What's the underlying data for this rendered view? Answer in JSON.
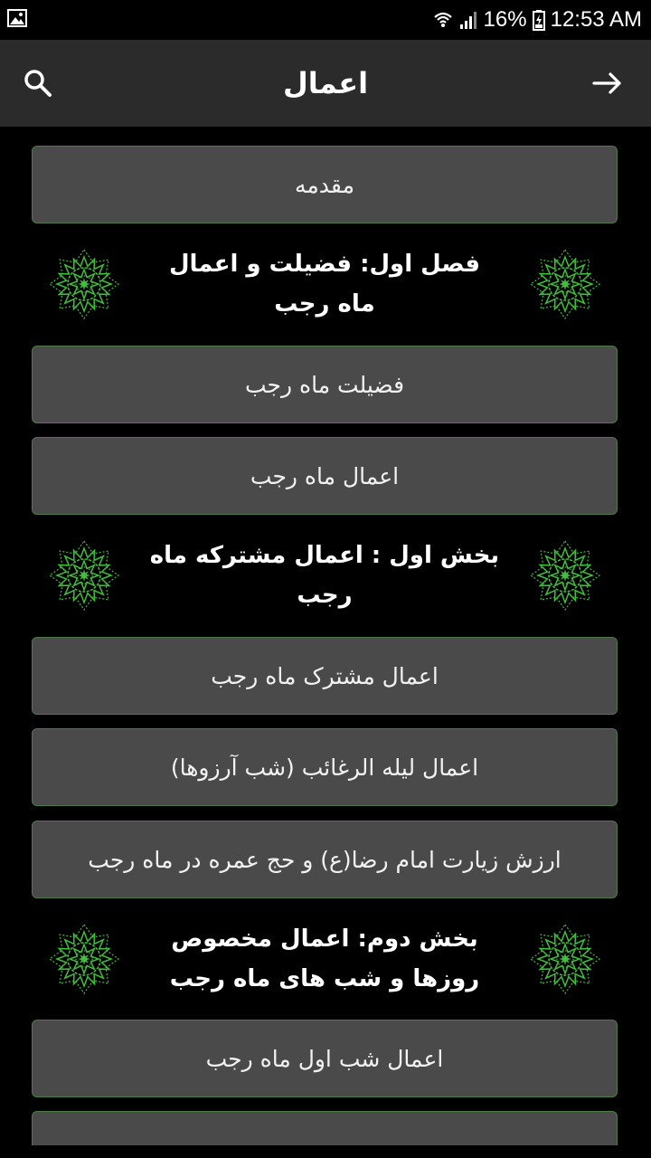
{
  "status_bar": {
    "left_icon": "image-icon",
    "battery_percent": "16%",
    "time": "12:53 AM"
  },
  "app_bar": {
    "title": "اعمال",
    "search_icon": "search-icon",
    "back_icon": "arrow-right-icon"
  },
  "items": {
    "intro": "مقدمه",
    "section1": "فصل اول: فضیلت و اعمال ماه رجب",
    "virtue": "فضیلت ماه رجب",
    "acts": "اعمال ماه رجب",
    "part1": "بخش اول : اعمال مشترکه ماه رجب",
    "common": "اعمال مشترک ماه رجب",
    "raghaib": "اعمال لیله الرغائب (شب آرزوها)",
    "ziyarat": "ارزش زیارت امام رضا(ع) و حج عمره در ماه رجب",
    "part2": "بخش دوم: اعمال مخصوص روزها و شب های ماه رجب",
    "first_night": "اعمال شب اول ماه رجب"
  },
  "colors": {
    "background": "#000000",
    "app_bar": "#2b2b2b",
    "button": "#4a4a4a",
    "button_border": "#4e7a48",
    "ornament": "#3fbf3a"
  }
}
